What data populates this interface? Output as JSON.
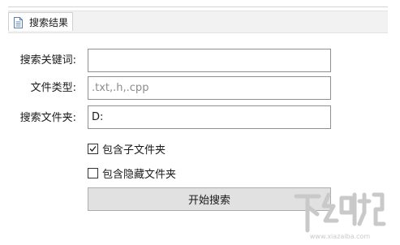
{
  "tab": {
    "label": "搜索结果",
    "icon": "document-icon"
  },
  "form": {
    "keyword": {
      "label": "搜索关键词:",
      "value": ""
    },
    "file_type": {
      "label": "文件类型:",
      "value": ".txt,.h,.cpp"
    },
    "folder": {
      "label": "搜索文件夹:",
      "value": "D:"
    },
    "include_subfolders": {
      "label": "包含子文件夹",
      "checked": true
    },
    "include_hidden": {
      "label": "包含隐藏文件夹",
      "checked": false
    },
    "start_button_label": "开始搜索"
  },
  "watermark": {
    "text": "下载吧",
    "url": "www.xiazaiba.com"
  },
  "colors": {
    "tab_bar_background": "#f2f2f2",
    "input_border": "#8f8f8f",
    "button_background": "#e1e1e1",
    "watermark": "#c9c9c9"
  }
}
